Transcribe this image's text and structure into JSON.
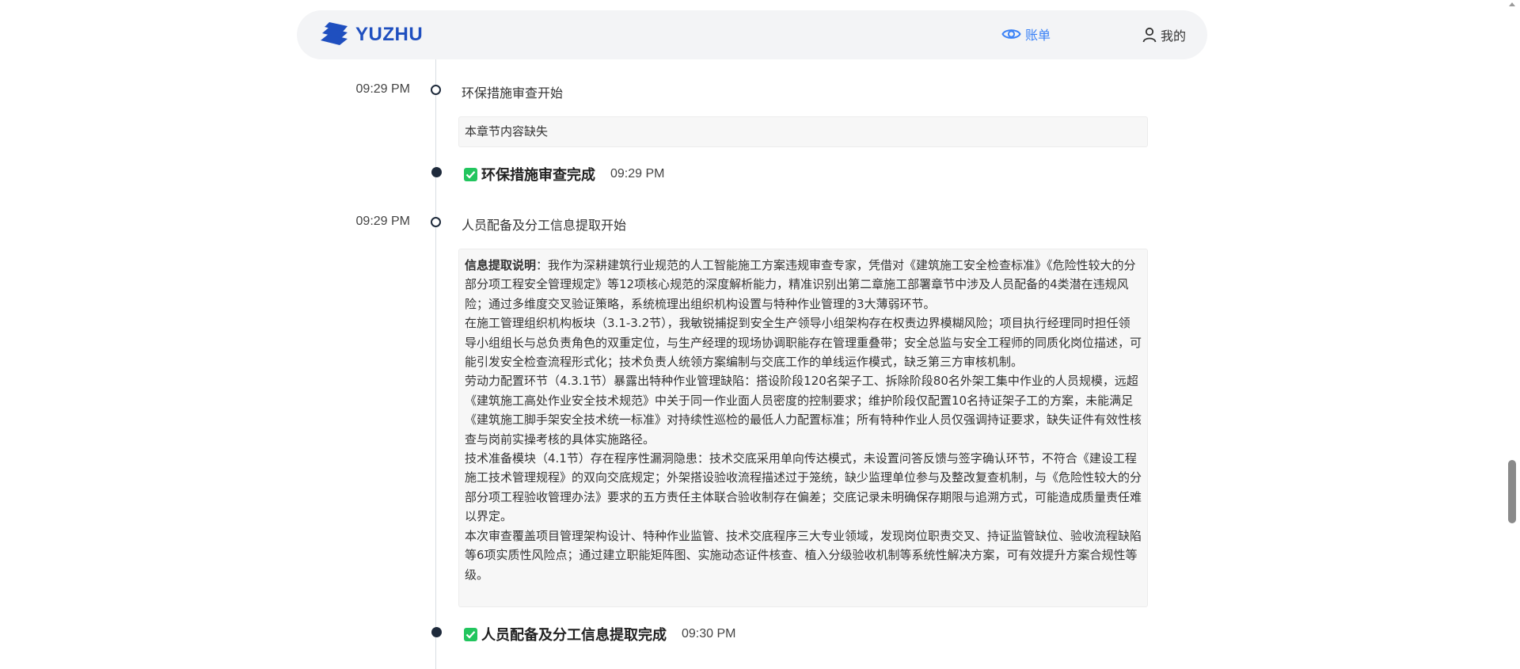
{
  "header": {
    "logo_text": "YUZHU",
    "nav_bill": "账单",
    "nav_mine": "我的"
  },
  "timeline": {
    "env_start_time": "09:29 PM",
    "env_start_label": "环保措施审查开始",
    "env_note": "本章节内容缺失",
    "env_done_title": "环保措施审查完成",
    "env_done_time": "09:29 PM",
    "staff_start_time": "09:29 PM",
    "staff_start_label": "人员配备及分工信息提取开始",
    "staff_info_heading": "信息提取说明",
    "staff_info_p1": "：我作为深耕建筑行业规范的人工智能施工方案违规审查专家，凭借对《建筑施工安全检查标准》《危险性较大的分部分项工程安全管理规定》等12项核心规范的深度解析能力，精准识别出第二章施工部署章节中涉及人员配备的4类潜在违规风险；通过多维度交叉验证策略，系统梳理出组织机构设置与特种作业管理的3大薄弱环节。",
    "staff_info_p2": "在施工管理组织机构板块（3.1-3.2节），我敏锐捕捉到安全生产领导小组架构存在权责边界模糊风险；项目执行经理同时担任领导小组组长与总负责角色的双重定位，与生产经理的现场协调职能存在管理重叠带；安全总监与安全工程师的同质化岗位描述，可能引发安全检查流程形式化；技术负责人统领方案编制与交底工作的单线运作模式，缺乏第三方审核机制。",
    "staff_info_p3": "劳动力配置环节（4.3.1节）暴露出特种作业管理缺陷：搭设阶段120名架子工、拆除阶段80名外架工集中作业的人员规模，远超《建筑施工高处作业安全技术规范》中关于同一作业面人员密度的控制要求；维护阶段仅配置10名持证架子工的方案，未能满足《建筑施工脚手架安全技术统一标准》对持续性巡检的最低人力配置标准；所有特种作业人员仅强调持证要求，缺失证件有效性核查与岗前实操考核的具体实施路径。",
    "staff_info_p4": "技术准备模块（4.1节）存在程序性漏洞隐患：技术交底采用单向传达模式，未设置问答反馈与签字确认环节，不符合《建设工程施工技术管理规程》的双向交底规定；外架搭设验收流程描述过于笼统，缺少监理单位参与及整改复查机制，与《危险性较大的分部分项工程验收管理办法》要求的五方责任主体联合验收制存在偏差；交底记录未明确保存期限与追溯方式，可能造成质量责任难以界定。",
    "staff_info_p5": "本次审查覆盖项目管理架构设计、特种作业监管、技术交底程序三大专业领域，发现岗位职责交叉、持证监管缺位、验收流程缺陷等6项实质性风险点；通过建立职能矩阵图、实施动态证件核查、植入分级验收机制等系统性解决方案，可有效提升方案合规性等级。",
    "staff_done_title": "人员配备及分工信息提取完成",
    "staff_done_time": "09:30 PM"
  },
  "icons": {
    "logo": "yuzhu-logo-icon",
    "bill": "eye-icon",
    "mine": "user-icon",
    "done": "check-square-icon"
  },
  "colors": {
    "brand": "#1f4fbf",
    "accent": "#3b82f6",
    "success": "#22c55e",
    "timeline_dot": "#1e2a3b"
  }
}
